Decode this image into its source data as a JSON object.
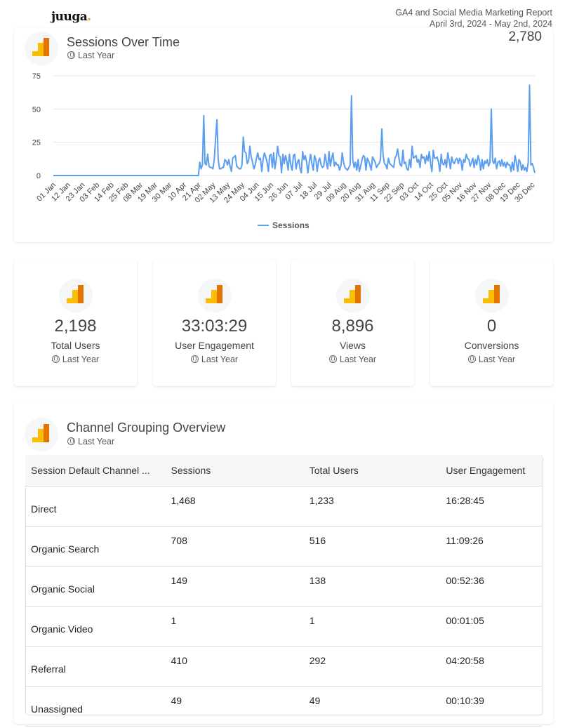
{
  "header": {
    "logo": "juuga",
    "report_title": "GA4 and Social Media Marketing Report",
    "date_range": "April 3rd, 2024 - May 2nd, 2024"
  },
  "sessions_card": {
    "title": "Sessions Over Time",
    "period": "Last Year",
    "total": "2,780",
    "icon": "google-analytics-icon"
  },
  "chart_data": {
    "type": "line",
    "title": "Sessions Over Time",
    "xlabel": "",
    "ylabel": "",
    "ylim": [
      0,
      75
    ],
    "yticks": [
      0,
      25,
      50,
      75
    ],
    "grid": true,
    "legend_placement": "bottom",
    "color": "#5b9ef0",
    "xticks": [
      "01 Jan",
      "12 Jan",
      "23 Jan",
      "03 Feb",
      "14 Feb",
      "25 Feb",
      "08 Mar",
      "19 Mar",
      "30 Mar",
      "10 Apr",
      "21 Apr",
      "02 May",
      "13 May",
      "24 May",
      "04 Jun",
      "15 Jun",
      "26 Jun",
      "07 Jul",
      "18 Jul",
      "29 Jul",
      "09 Aug",
      "20 Aug",
      "31 Aug",
      "11 Sep",
      "22 Sep",
      "03 Oct",
      "14 Oct",
      "25 Oct",
      "05 Nov",
      "16 Nov",
      "27 Nov",
      "08 Dec",
      "19 Dec",
      "30 Dec"
    ],
    "series": [
      {
        "name": "Sessions",
        "values": [
          0,
          0,
          0,
          0,
          0,
          0,
          0,
          0,
          0,
          0,
          0,
          0,
          0,
          0,
          0,
          0,
          0,
          0,
          0,
          0,
          0,
          0,
          0,
          0,
          0,
          0,
          0,
          0,
          0,
          0,
          0,
          0,
          0,
          0,
          0,
          0,
          0,
          0,
          0,
          0,
          0,
          0,
          0,
          0,
          0,
          0,
          0,
          0,
          0,
          0,
          0,
          0,
          0,
          0,
          0,
          0,
          0,
          0,
          0,
          0,
          0,
          0,
          0,
          0,
          0,
          0,
          0,
          0,
          0,
          0,
          0,
          0,
          0,
          0,
          0,
          0,
          0,
          0,
          0,
          0,
          0,
          0,
          0,
          0,
          0,
          0,
          0,
          0,
          0,
          0,
          0,
          0,
          0,
          0,
          0,
          0,
          0,
          0,
          0,
          0,
          0,
          0,
          0,
          0,
          0,
          0,
          0,
          0,
          0,
          0,
          0,
          10,
          5,
          8,
          45,
          9,
          8,
          16,
          7,
          6,
          6,
          5,
          12,
          28,
          42,
          12,
          5,
          5,
          6,
          6,
          12,
          11,
          8,
          12,
          7,
          3,
          13,
          14,
          15,
          7,
          6,
          5,
          5,
          8,
          29,
          18,
          17,
          9,
          11,
          22,
          14,
          10,
          5,
          8,
          13,
          17,
          12,
          13,
          3,
          12,
          17,
          14,
          10,
          3,
          15,
          16,
          6,
          17,
          5,
          12,
          22,
          15,
          14,
          2,
          16,
          9,
          15,
          11,
          4,
          16,
          8,
          4,
          15,
          16,
          5,
          10,
          12,
          5,
          2,
          18,
          12,
          15,
          10,
          2,
          10,
          16,
          9,
          4,
          15,
          12,
          3,
          11,
          13,
          8,
          6,
          7,
          16,
          10,
          5,
          18,
          7,
          13,
          17,
          7,
          10,
          8,
          8,
          4,
          7,
          17,
          10,
          6,
          5,
          4,
          6,
          8,
          60,
          12,
          6,
          10,
          4,
          12,
          3,
          7,
          12,
          15,
          14,
          4,
          13,
          11,
          8,
          4,
          14,
          12,
          10,
          6,
          8,
          9,
          12,
          35,
          15,
          9,
          8,
          5,
          13,
          9,
          8,
          7,
          6,
          13,
          15,
          20,
          13,
          8,
          7,
          19,
          9,
          10,
          5,
          4,
          12,
          6,
          22,
          13,
          14,
          15,
          10,
          12,
          6,
          16,
          13,
          14,
          9,
          15,
          11,
          18,
          9,
          3,
          19,
          13,
          13,
          14,
          10,
          3,
          16,
          9,
          8,
          12,
          6,
          17,
          12,
          5,
          14,
          10,
          9,
          12,
          13,
          9,
          13,
          11,
          4,
          12,
          10,
          16,
          13,
          12,
          7,
          10,
          13,
          6,
          12,
          8,
          15,
          11,
          4,
          12,
          5,
          11,
          9,
          12,
          7,
          10,
          50,
          11,
          9,
          13,
          5,
          10,
          11,
          7,
          12,
          7,
          10,
          6,
          10,
          8,
          8,
          3,
          10,
          4,
          15,
          10,
          3,
          12,
          10,
          4,
          8,
          4,
          6,
          3,
          10,
          68,
          8,
          9,
          6,
          2
        ]
      }
    ]
  },
  "kpis": [
    {
      "value": "2,198",
      "label": "Total Users",
      "period": "Last Year"
    },
    {
      "value": "33:03:29",
      "label": "User Engagement",
      "period": "Last Year"
    },
    {
      "value": "8,896",
      "label": "Views",
      "period": "Last Year"
    },
    {
      "value": "0",
      "label": "Conversions",
      "period": "Last Year"
    }
  ],
  "channel": {
    "title": "Channel Grouping Overview",
    "period": "Last Year",
    "columns": [
      "Session Default Channel ...",
      "Sessions",
      "Total Users",
      "User Engagement"
    ],
    "rows": [
      [
        "Direct",
        "1,468",
        "1,233",
        "16:28:45"
      ],
      [
        "Organic Search",
        "708",
        "516",
        "11:09:26"
      ],
      [
        "Organic Social",
        "149",
        "138",
        "00:52:36"
      ],
      [
        "Organic Video",
        "1",
        "1",
        "00:01:05"
      ],
      [
        "Referral",
        "410",
        "292",
        "04:20:58"
      ],
      [
        "Unassigned",
        "49",
        "49",
        "00:10:39"
      ]
    ]
  }
}
